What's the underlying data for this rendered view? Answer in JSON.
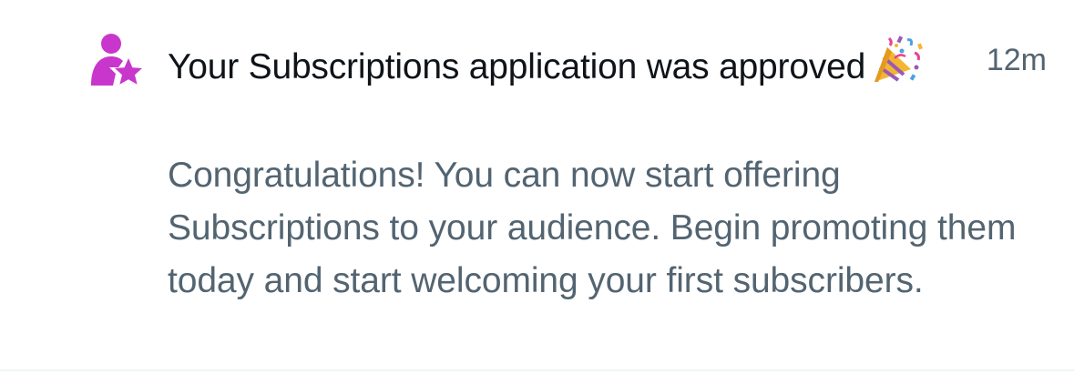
{
  "notification": {
    "icon": "subscriptions-person-star-icon",
    "accent_color": "#c936cc",
    "title": "Your Subscriptions application was approved",
    "emoji": "🎉",
    "emoji_icon": "party-popper-icon",
    "time": "12m",
    "body": "Congratulations! You can now start offering Subscriptions to your audience. Begin promoting them today and start welcoming your first subscribers."
  }
}
